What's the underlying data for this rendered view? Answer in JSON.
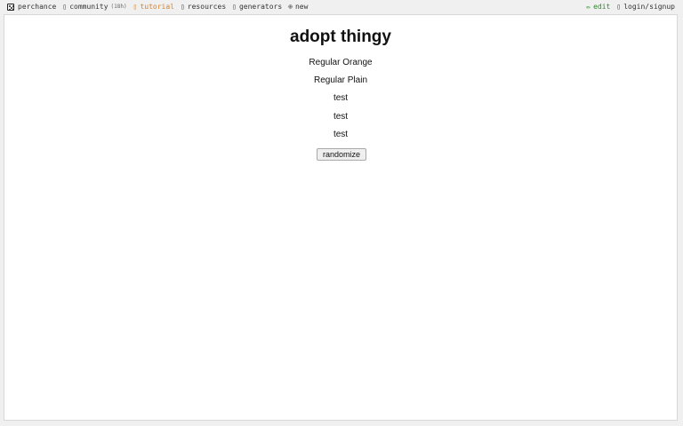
{
  "topbar": {
    "brand": {
      "label": "perchance",
      "icon": "dice-icon"
    },
    "community": {
      "label": "community",
      "count": "(18h)",
      "icon": "chat-icon"
    },
    "tutorial": {
      "label": "tutorial",
      "icon": "book-icon",
      "color": "#d9822b"
    },
    "resources": {
      "label": "resources",
      "icon": "folder-icon"
    },
    "generators": {
      "label": "generators",
      "icon": "list-icon"
    },
    "new": {
      "label": "new",
      "icon": "plus-circle-icon"
    },
    "edit": {
      "label": "edit",
      "icon": "pencil-icon",
      "color": "#2e8b2e"
    },
    "login": {
      "label": "login/signup",
      "icon": "user-icon"
    }
  },
  "main": {
    "title": "adopt thingy",
    "lines": [
      "Regular Orange",
      "Regular Plain",
      "test",
      "test",
      "test"
    ],
    "button_label": "randomize"
  }
}
